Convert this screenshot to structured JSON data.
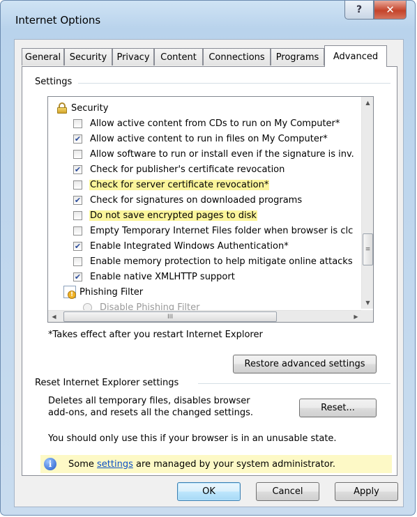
{
  "window": {
    "title": "Internet Options",
    "help_glyph": "?",
    "close_glyph": "✕"
  },
  "tabs": [
    {
      "label": "General"
    },
    {
      "label": "Security"
    },
    {
      "label": "Privacy"
    },
    {
      "label": "Content"
    },
    {
      "label": "Connections"
    },
    {
      "label": "Programs"
    },
    {
      "label": "Advanced",
      "active": true
    }
  ],
  "settings": {
    "group_label": "Settings",
    "category": "Security",
    "items": [
      {
        "label": "Allow active content from CDs to run on My Computer*",
        "checked": false
      },
      {
        "label": "Allow active content to run in files on My Computer*",
        "checked": true
      },
      {
        "label": "Allow software to run or install even if the signature is inv.",
        "checked": false
      },
      {
        "label": "Check for publisher's certificate revocation",
        "checked": true
      },
      {
        "label": "Check for server certificate revocation*",
        "checked": false,
        "highlighted": true
      },
      {
        "label": "Check for signatures on downloaded programs",
        "checked": true
      },
      {
        "label": "Do not save encrypted pages to disk",
        "checked": false,
        "highlighted": true
      },
      {
        "label": "Empty Temporary Internet Files folder when browser is clc",
        "checked": false
      },
      {
        "label": "Enable Integrated Windows Authentication*",
        "checked": true
      },
      {
        "label": "Enable memory protection to help mitigate online attacks",
        "checked": false
      },
      {
        "label": "Enable native XMLHTTP support",
        "checked": true
      }
    ],
    "subcategory": "Phishing Filter",
    "radio_label": "Disable Phishing Filter",
    "footnote": "*Takes effect after you restart Internet Explorer",
    "restore_button": "Restore advanced settings",
    "scroll_grip": "≡",
    "hscroll_grip": "III"
  },
  "reset": {
    "group_label": "Reset Internet Explorer settings",
    "description_line1": "Deletes all temporary files, disables browser",
    "description_line2": "add-ons, and resets all the changed settings.",
    "button": "Reset...",
    "warning": "You should only use this if your browser is in an unusable state."
  },
  "info": {
    "prefix": "Some ",
    "link": "settings",
    "suffix": " are managed by your system administrator."
  },
  "buttons": {
    "ok": "OK",
    "cancel": "Cancel",
    "apply": "Apply"
  }
}
